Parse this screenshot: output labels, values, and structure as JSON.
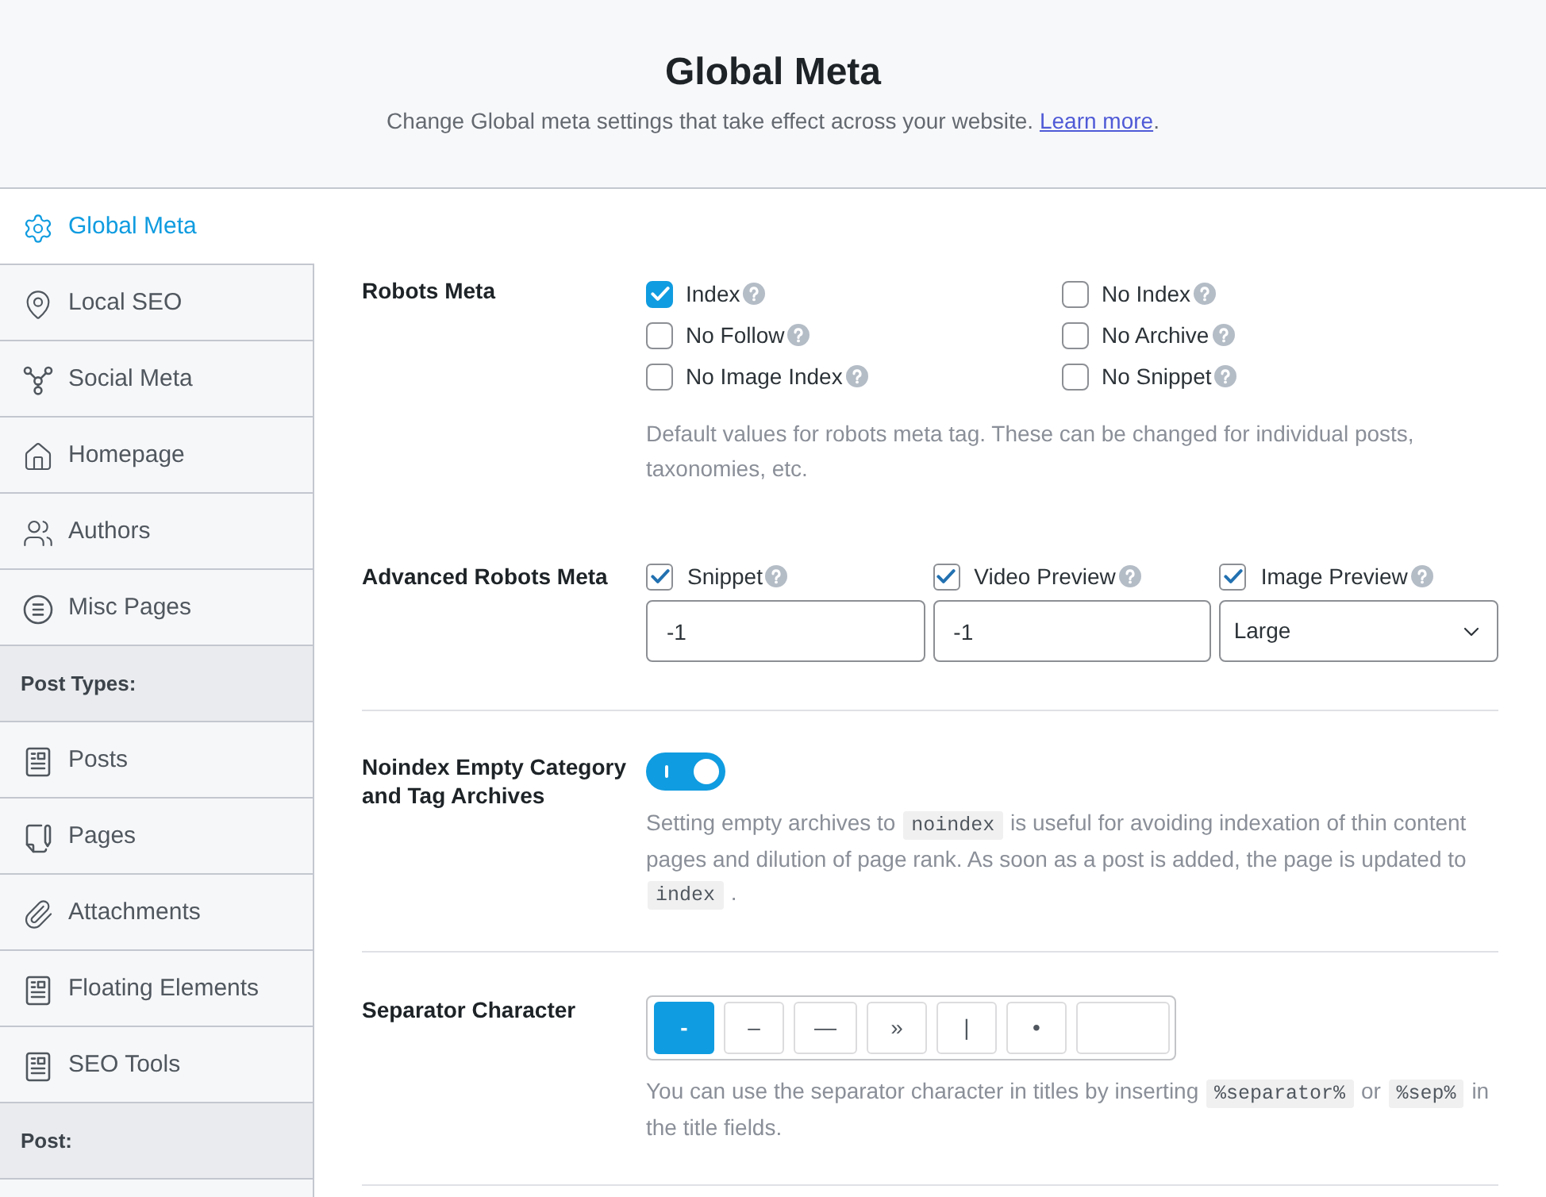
{
  "header": {
    "title": "Global Meta",
    "subtitle": "Change Global meta settings that take effect across your website.",
    "link": "Learn more",
    "end": "."
  },
  "sidebar": {
    "items": [
      {
        "kind": "item",
        "label": "Global Meta",
        "selected": true
      },
      {
        "kind": "item",
        "label": "Local SEO",
        "selected": false
      },
      {
        "kind": "item",
        "label": "Social Meta",
        "selected": false
      },
      {
        "kind": "item",
        "label": "Homepage",
        "selected": false
      },
      {
        "kind": "item",
        "label": "Authors",
        "selected": false
      },
      {
        "kind": "item",
        "label": "Misc Pages",
        "selected": false
      },
      {
        "kind": "heading",
        "label": "Post Types:"
      },
      {
        "kind": "item",
        "label": "Posts",
        "selected": false
      },
      {
        "kind": "item",
        "label": "Pages",
        "selected": false
      },
      {
        "kind": "item",
        "label": "Attachments",
        "selected": false
      },
      {
        "kind": "item",
        "label": "Floating Elements",
        "selected": false
      },
      {
        "kind": "item",
        "label": "SEO Tools",
        "selected": false
      },
      {
        "kind": "heading",
        "label": "Post:"
      }
    ]
  },
  "settings": [
    {
      "kind": "robots",
      "label": "Robots Meta",
      "options": [
        {
          "label": "Index",
          "checked": true
        },
        {
          "label": "No Index",
          "checked": false
        },
        {
          "label": "No Follow",
          "checked": false
        },
        {
          "label": "No Archive",
          "checked": false
        },
        {
          "label": "No Image Index",
          "checked": false
        },
        {
          "label": "No Snippet",
          "checked": false
        }
      ],
      "description": [
        {
          "kind": "text",
          "text": "Default values for robots meta tag. These can be changed for individual posts, taxonomies, etc."
        }
      ]
    },
    {
      "kind": "advanced",
      "label": "Advanced Robots Meta",
      "options": [
        {
          "kind": "number",
          "label": "Snippet",
          "checked": true,
          "value": "-1"
        },
        {
          "kind": "number",
          "label": "Video Preview",
          "checked": true,
          "value": "-1"
        },
        {
          "kind": "select",
          "label": "Image Preview",
          "checked": true,
          "value": "Large"
        }
      ]
    },
    {
      "kind": "toggle",
      "label": "Noindex Empty Category and Tag Archives",
      "on": true,
      "description": [
        {
          "kind": "text",
          "text": "Setting empty archives to"
        },
        {
          "kind": "code",
          "text": "noindex"
        },
        {
          "kind": "text",
          "text": "is useful for avoiding indexation of thin content pages and dilution of page rank. As soon as a post is added, the page is updated to"
        },
        {
          "kind": "code",
          "text": "index"
        },
        {
          "kind": "text",
          "text": "."
        }
      ]
    },
    {
      "kind": "separator",
      "label": "Separator Character",
      "options": [
        {
          "kind": "char",
          "text": "-",
          "selected": true
        },
        {
          "kind": "char",
          "text": "–",
          "selected": false
        },
        {
          "kind": "char",
          "text": "—",
          "selected": false
        },
        {
          "kind": "char",
          "text": "»",
          "selected": false
        },
        {
          "kind": "char",
          "text": "|",
          "selected": false
        },
        {
          "kind": "char",
          "text": "•",
          "selected": false
        },
        {
          "kind": "input",
          "selected": false
        }
      ],
      "description": [
        {
          "kind": "text",
          "text": "You can use the separator character in titles by inserting"
        },
        {
          "kind": "code",
          "text": "%separator%"
        },
        {
          "kind": "text",
          "text": "or"
        },
        {
          "kind": "code",
          "text": "%sep%"
        },
        {
          "kind": "text",
          "text": "in the title fields."
        }
      ]
    }
  ]
}
